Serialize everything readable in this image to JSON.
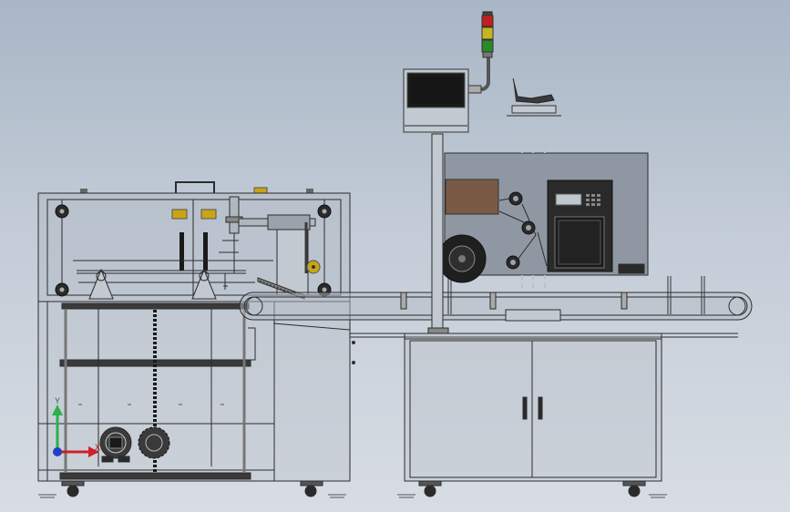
{
  "viewport": {
    "background_top": "#a9b6c6",
    "background_bottom": "#d8dde4"
  },
  "triad": {
    "y_axis_label": "Y",
    "x_axis_label": "X",
    "y_color": "#2bb14a",
    "x_color": "#d0202a",
    "z_color": "#2040c8"
  },
  "colors": {
    "line": "#2c2c2c",
    "frame_gray": "#8f98a2",
    "dark_panel": "#3a3a3a",
    "screen": "#1a1a1a",
    "bronze_roll": "#7a5a44",
    "knob_yellow": "#c9a514",
    "signal_red": "#c41e1e",
    "signal_yellow": "#c8b41e",
    "signal_green": "#2a8a2a"
  },
  "components": [
    "left-wrapping-machine",
    "right-labeling-machine",
    "belt-conveyor",
    "touch-screen-panel",
    "signal-tower-light",
    "printer-unit",
    "adjust-handwheel"
  ]
}
